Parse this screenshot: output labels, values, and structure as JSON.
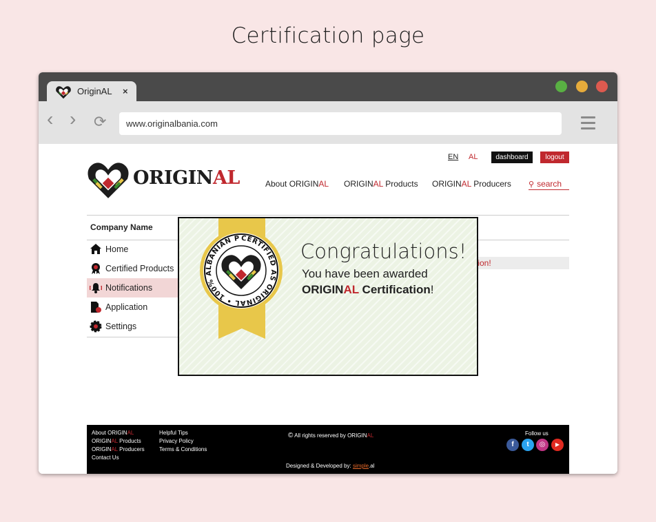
{
  "page": {
    "heading": "Certification page"
  },
  "browser": {
    "tab_title": "OriginAL",
    "tab_close": "×",
    "url": "www.originalbania.com",
    "back_icon": "‹",
    "forward_icon": "›",
    "reload_icon": "⟳"
  },
  "header": {
    "lang_en": "EN",
    "lang_al": "AL",
    "dashboard_label": "dashboard",
    "logout_label": "logout",
    "brand_dark": "ORIGIN",
    "brand_red": "AL"
  },
  "nav": {
    "about_prefix": "About ORIGIN",
    "about_red": "AL",
    "products_prefix": "ORIGIN",
    "products_red": "AL",
    "products_suffix": " Products",
    "producers_prefix": "ORIGIN",
    "producers_red": "AL",
    "producers_suffix": " Producers",
    "search_label": "search"
  },
  "sidebar": {
    "company_name": "Company Name",
    "items": [
      {
        "label": "Home",
        "icon": "home-icon"
      },
      {
        "label": "Certified Products",
        "icon": "award-icon"
      },
      {
        "label": "Notifications",
        "icon": "bell-icon",
        "active": true
      },
      {
        "label": "Application",
        "icon": "document-icon"
      },
      {
        "label": "Settings",
        "icon": "gear-icon"
      }
    ]
  },
  "notice": {
    "partial_text": "tion!"
  },
  "modal": {
    "title": "Congratulations!",
    "line1": "You have been awarded",
    "cert_dark": "ORIGIN",
    "cert_red": "AL",
    "cert_suffix": " Certification",
    "cert_end": "!",
    "seal_text": "CERTIFIED AS ORIGINAL • 100% ALBANIAN PRODUCT •"
  },
  "footer": {
    "col1": [
      {
        "prefix": "About ORIGIN",
        "red": "AL",
        "suffix": ""
      },
      {
        "prefix": "ORIGIN",
        "red": "AL",
        "suffix": " Products"
      },
      {
        "prefix": "ORIGIN",
        "red": "AL",
        "suffix": " Producers"
      },
      {
        "prefix": "Contact Us",
        "red": "",
        "suffix": ""
      }
    ],
    "col2": [
      "Helpful Tips",
      "Privacy Policy",
      "Terms & Conditions"
    ],
    "copyright_prefix": "All rights reserved by ORIGIN",
    "copyright_red": "AL",
    "follow_label": "Follow us",
    "designed_prefix": "Designed & Developed by: ",
    "designed_link": "simple",
    "designed_suffix": ".al",
    "social": [
      {
        "name": "facebook",
        "glyph": "f",
        "color": "#3b5a9a"
      },
      {
        "name": "twitter",
        "glyph": "t",
        "color": "#2aa3ef"
      },
      {
        "name": "instagram",
        "glyph": "◎",
        "color": "#c13584"
      },
      {
        "name": "youtube",
        "glyph": "▶",
        "color": "#e02a20"
      }
    ]
  },
  "colors": {
    "brand_red": "#c0282e",
    "brand_green": "#3a8a2f",
    "brand_yellow": "#e8c74a",
    "modal_bg": "#ecf3e4"
  }
}
